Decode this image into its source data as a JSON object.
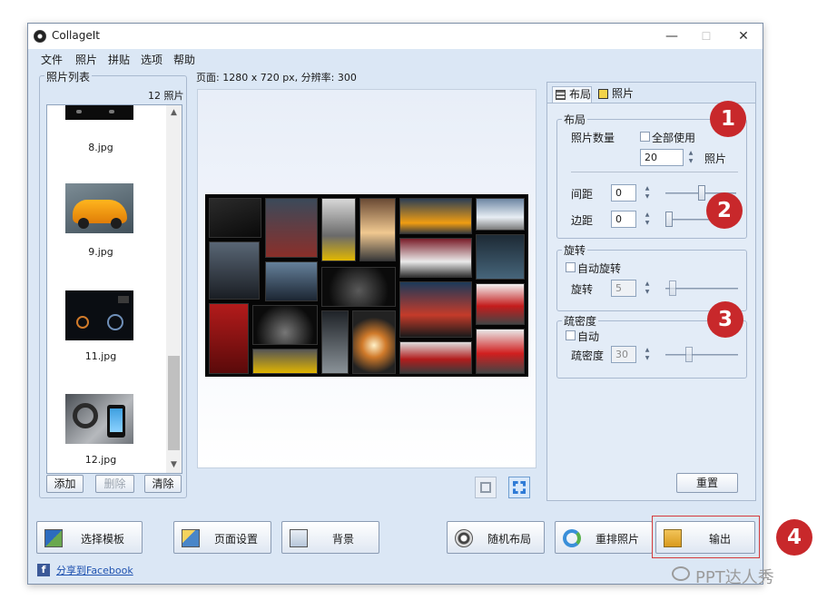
{
  "window": {
    "title": "CollageIt",
    "minimize": "—",
    "maximize": "☐",
    "close": "✕"
  },
  "menu": [
    "文件",
    "照片",
    "拼贴",
    "选项",
    "帮助"
  ],
  "photo_list": {
    "title": "照片列表",
    "count_label": "12 照片",
    "items": [
      "8.jpg",
      "9.jpg",
      "11.jpg",
      "12.jpg"
    ],
    "buttons": {
      "add": "添加",
      "delete": "删除",
      "clear": "清除"
    }
  },
  "page_info": "页面: 1280 x 720 px, 分辨率: 300",
  "tabs": {
    "layout": "布局",
    "photo": "照片"
  },
  "layout_group": {
    "title": "布局",
    "photo_count_label": "照片数量",
    "use_all_label": "全部使用",
    "count_value": "20",
    "count_unit": "照片",
    "spacing_label": "间距",
    "spacing_value": "0",
    "margin_label": "边距",
    "margin_value": "0"
  },
  "rotation_group": {
    "title": "旋转",
    "auto_label": "自动旋转",
    "rotation_label": "旋转",
    "rotation_value": "5"
  },
  "density_group": {
    "title": "疏密度",
    "auto_label": "自动",
    "density_label": "疏密度",
    "density_value": "30"
  },
  "reset_button": "重置",
  "toolbar": {
    "choose_template": "选择模板",
    "page_setup": "页面设置",
    "background": "背景",
    "random_layout": "随机布局",
    "shuffle_photos": "重排照片",
    "export": "输出"
  },
  "share_link": "分享到Facebook",
  "badges": [
    "1",
    "2",
    "3",
    "4"
  ],
  "watermark": "PPT达人秀"
}
